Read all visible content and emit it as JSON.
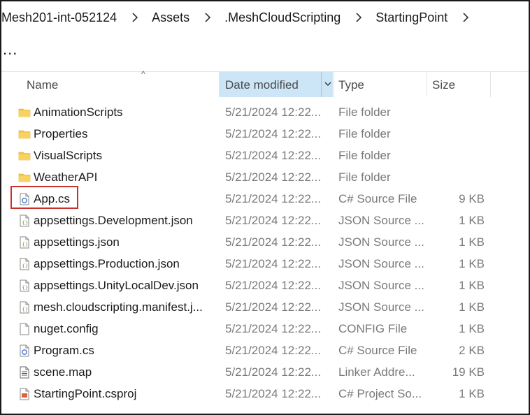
{
  "breadcrumb": {
    "items": [
      "Mesh201-int-052124",
      "Assets",
      ".MeshCloudScripting",
      "StartingPoint"
    ]
  },
  "toolbar": {
    "overflow_label": "..."
  },
  "columns": {
    "name": "Name",
    "date": "Date modified",
    "type": "Type",
    "size": "Size"
  },
  "files": [
    {
      "name": "AnimationScripts",
      "date": "5/21/2024 12:22...",
      "type": "File folder",
      "size": "",
      "icon": "folder-icon"
    },
    {
      "name": "Properties",
      "date": "5/21/2024 12:22...",
      "type": "File folder",
      "size": "",
      "icon": "folder-icon"
    },
    {
      "name": "VisualScripts",
      "date": "5/21/2024 12:22...",
      "type": "File folder",
      "size": "",
      "icon": "folder-icon"
    },
    {
      "name": "WeatherAPI",
      "date": "5/21/2024 12:22...",
      "type": "File folder",
      "size": "",
      "icon": "folder-icon"
    },
    {
      "name": "App.cs",
      "date": "5/21/2024 12:22...",
      "type": "C# Source File",
      "size": "9 KB",
      "icon": "csharp-file-icon"
    },
    {
      "name": "appsettings.Development.json",
      "date": "5/21/2024 12:22...",
      "type": "JSON Source ...",
      "size": "1 KB",
      "icon": "json-file-icon"
    },
    {
      "name": "appsettings.json",
      "date": "5/21/2024 12:22...",
      "type": "JSON Source ...",
      "size": "1 KB",
      "icon": "json-file-icon"
    },
    {
      "name": "appsettings.Production.json",
      "date": "5/21/2024 12:22...",
      "type": "JSON Source ...",
      "size": "1 KB",
      "icon": "json-file-icon"
    },
    {
      "name": "appsettings.UnityLocalDev.json",
      "date": "5/21/2024 12:22...",
      "type": "JSON Source ...",
      "size": "1 KB",
      "icon": "json-file-icon"
    },
    {
      "name": "mesh.cloudscripting.manifest.j...",
      "date": "5/21/2024 12:22...",
      "type": "JSON Source ...",
      "size": "1 KB",
      "icon": "json-file-icon"
    },
    {
      "name": "nuget.config",
      "date": "5/21/2024 12:22...",
      "type": "CONFIG File",
      "size": "1 KB",
      "icon": "config-file-icon"
    },
    {
      "name": "Program.cs",
      "date": "5/21/2024 12:22...",
      "type": "C# Source File",
      "size": "2 KB",
      "icon": "csharp-file-icon"
    },
    {
      "name": "scene.map",
      "date": "5/21/2024 12:22...",
      "type": "Linker Addre...",
      "size": "19 KB",
      "icon": "map-file-icon"
    },
    {
      "name": "StartingPoint.csproj",
      "date": "5/21/2024 12:22...",
      "type": "C# Project So...",
      "size": "1 KB",
      "icon": "csproj-file-icon"
    }
  ],
  "colors": {
    "sort_header_bg": "#cde6f7",
    "highlight_border": "#c8302c",
    "folder": "#f4c542"
  }
}
